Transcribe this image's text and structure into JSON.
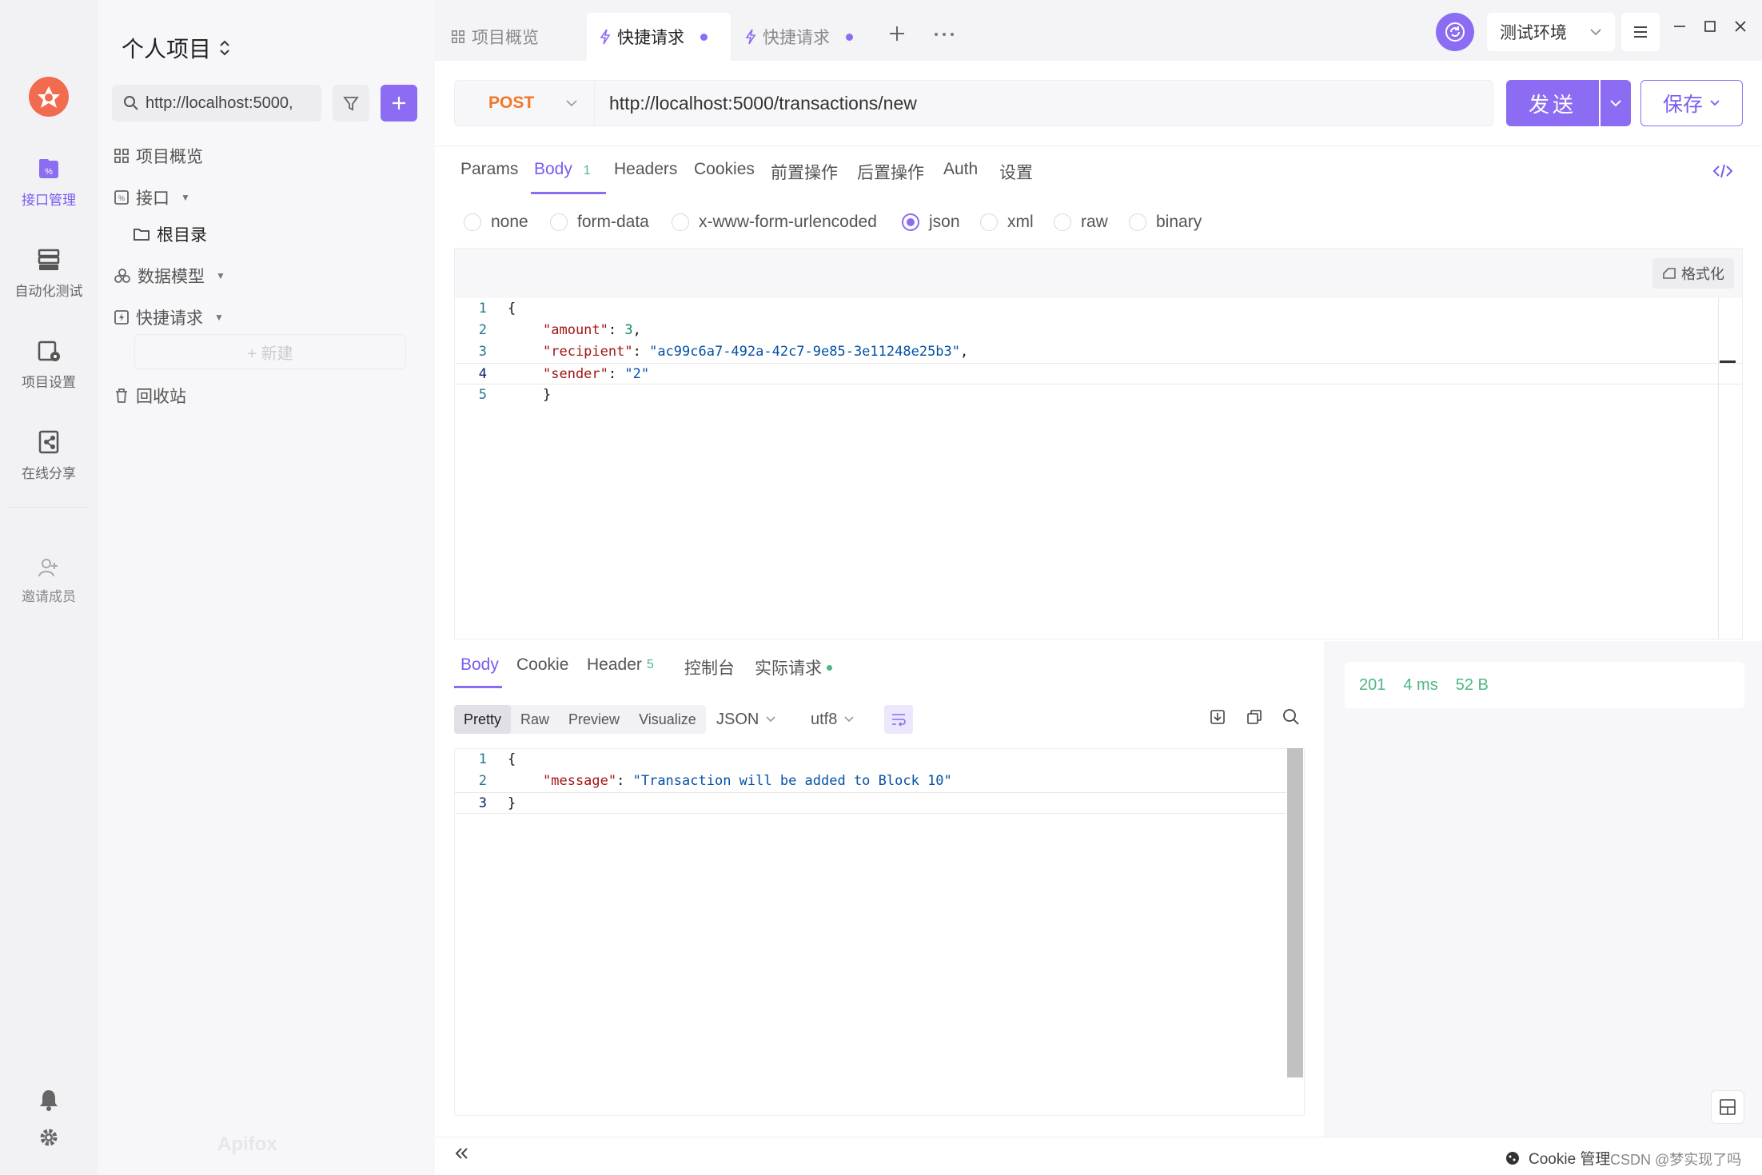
{
  "rail": {
    "items": [
      {
        "label": "接口管理"
      },
      {
        "label": "自动化测试"
      },
      {
        "label": "项目设置"
      },
      {
        "label": "在线分享"
      },
      {
        "label": "邀请成员"
      }
    ]
  },
  "sidebar": {
    "project_title": "个人项目",
    "search_value": "http://localhost:5000,",
    "tree": {
      "overview": "项目概览",
      "api": "接口",
      "root": "根目录",
      "models": "数据模型",
      "quick": "快捷请求",
      "new": "+ 新建",
      "trash": "回收站"
    },
    "brand": "Apifox"
  },
  "tabs": [
    {
      "label": "项目概览"
    },
    {
      "label": "快捷请求"
    },
    {
      "label": "快捷请求"
    }
  ],
  "env": {
    "label": "测试环境"
  },
  "request": {
    "method": "POST",
    "url": "http://localhost:5000/transactions/new",
    "send_label": "发送",
    "save_label": "保存",
    "tabs": {
      "params": "Params",
      "body": "Body",
      "body_count": "1",
      "headers": "Headers",
      "cookies": "Cookies",
      "pre": "前置操作",
      "post": "后置操作",
      "auth": "Auth",
      "settings": "设置"
    },
    "body_types": [
      "none",
      "form-data",
      "x-www-form-urlencoded",
      "json",
      "xml",
      "raw",
      "binary"
    ],
    "body_type_selected": "json",
    "format_label": "格式化",
    "lines": [
      "1",
      "2",
      "3",
      "4",
      "5"
    ],
    "code": {
      "l1": "{",
      "amount_key": "\"amount\"",
      "amount_val": "3",
      "recipient_key": "\"recipient\"",
      "recipient_val": "\"ac99c6a7-492a-42c7-9e85-3e11248e25b3\"",
      "sender_key": "\"sender\"",
      "sender_val": "\"2\"",
      "l5": "}"
    }
  },
  "response": {
    "tabs": {
      "body": "Body",
      "cookie": "Cookie",
      "header": "Header",
      "header_count": "5",
      "console": "控制台",
      "actual": "实际请求"
    },
    "views": [
      "Pretty",
      "Raw",
      "Preview",
      "Visualize"
    ],
    "format": "JSON",
    "encoding": "utf8",
    "lines": [
      "1",
      "2",
      "3"
    ],
    "code": {
      "l1": "{",
      "message_key": "\"message\"",
      "message_val": "\"Transaction will be added to Block 10\"",
      "l3": "}"
    },
    "status": {
      "code": "201",
      "time": "4 ms",
      "size": "52 B"
    }
  },
  "footer": {
    "cookie_label": "Cookie 管理",
    "watermark": "CSDN @梦实现了吗"
  },
  "colors": {
    "accent": "#8c6cf2",
    "method": "#f07826",
    "success": "#4cb782"
  }
}
